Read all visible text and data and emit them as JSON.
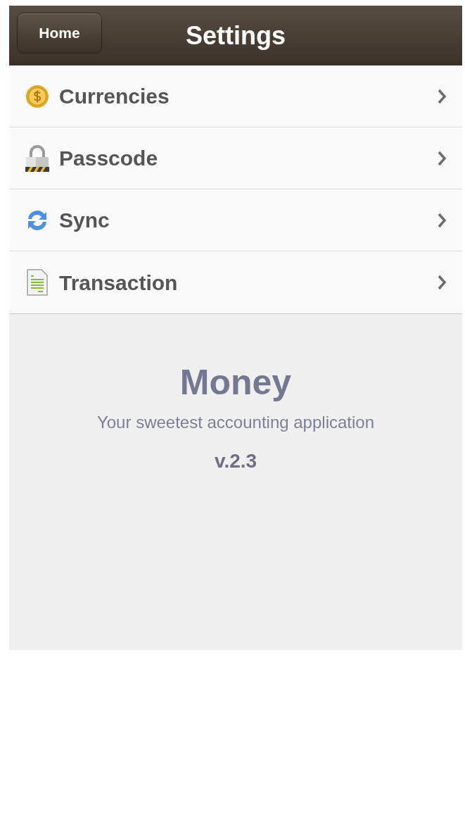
{
  "nav_bar": {
    "back_button": "Home",
    "title": "Settings"
  },
  "settings": [
    {
      "label": "Currencies"
    },
    {
      "label": "Passcode"
    },
    {
      "label": "Sync"
    },
    {
      "label": "Transaction"
    }
  ],
  "about": {
    "app_name": "Money",
    "tagline": "Your sweetest accounting application",
    "version": "v.2.3"
  }
}
